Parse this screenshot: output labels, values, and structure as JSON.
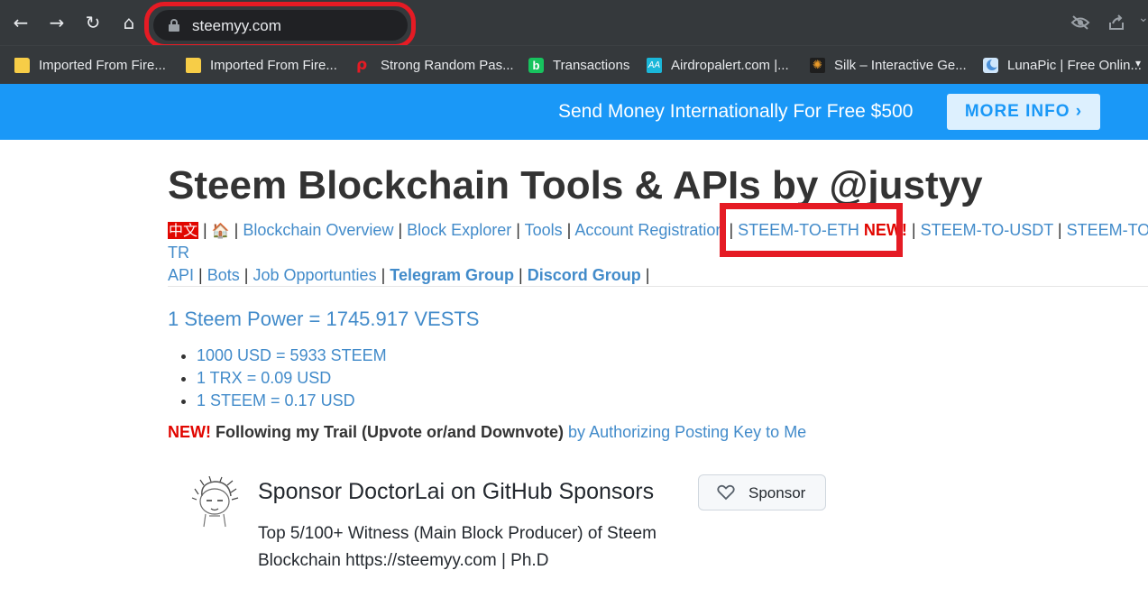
{
  "browser": {
    "url": "steemyy.com",
    "bookmarks": [
      {
        "label": "Imported From Fire...",
        "icon": "folder-icon",
        "color": "#f7cd47"
      },
      {
        "label": "Imported From Fire...",
        "icon": "folder-icon",
        "color": "#f7cd47"
      },
      {
        "label": "Strong Random Pas...",
        "icon": "key-icon",
        "color": "#e51b24"
      },
      {
        "label": "Transactions",
        "icon": "b-logo-icon",
        "color": "#17c35e"
      },
      {
        "label": "Airdropalert.com |...",
        "icon": "airdrop-icon",
        "color": "#1ab7d9"
      },
      {
        "label": "Silk – Interactive Ge...",
        "icon": "silk-icon",
        "color": "#e89a2a"
      },
      {
        "label": "LunaPic | Free Onlin...",
        "icon": "lunapic-icon",
        "color": "#4a90d9"
      }
    ]
  },
  "banner": {
    "text": "Send Money Internationally For Free $500",
    "button": "MORE INFO ›"
  },
  "page": {
    "title": "Steem Blockchain Tools & APIs by @justyy",
    "nav": {
      "lang": "中文",
      "home": "🏠",
      "links": {
        "overview": "Blockchain Overview",
        "explorer": "Block Explorer",
        "tools": "Tools",
        "registration": "Account Registration",
        "eth": "STEEM-TO-ETH",
        "new": "NEW!",
        "usdt": "STEEM-TO-USDT",
        "trx": "STEEM-TO-TR",
        "api": "API",
        "bots": "Bots",
        "jobs": "Job Opportunties",
        "telegram": "Telegram Group",
        "discord": "Discord Group"
      },
      "separator": "|"
    },
    "steem_power": "1 Steem Power = 1745.917 VESTS",
    "rates": [
      "1000 USD = 5933 STEEM",
      "1 TRX = 0.09 USD",
      "1 STEEM = 0.17 USD"
    ],
    "trail": {
      "new": "NEW!",
      "bold": "Following my Trail (Upvote or/and Downvote)",
      "link": "by Authorizing Posting Key to Me"
    },
    "sponsor": {
      "title": "Sponsor DoctorLai on GitHub Sponsors",
      "description": "Top 5/100+ Witness (Main Block Producer) of Steem Blockchain https://steemyy.com | Ph.D",
      "button": "Sponsor"
    }
  },
  "colors": {
    "banner": "#1a98f7",
    "link": "#428bca",
    "highlight": "#e51b24",
    "new": "#e10600"
  }
}
